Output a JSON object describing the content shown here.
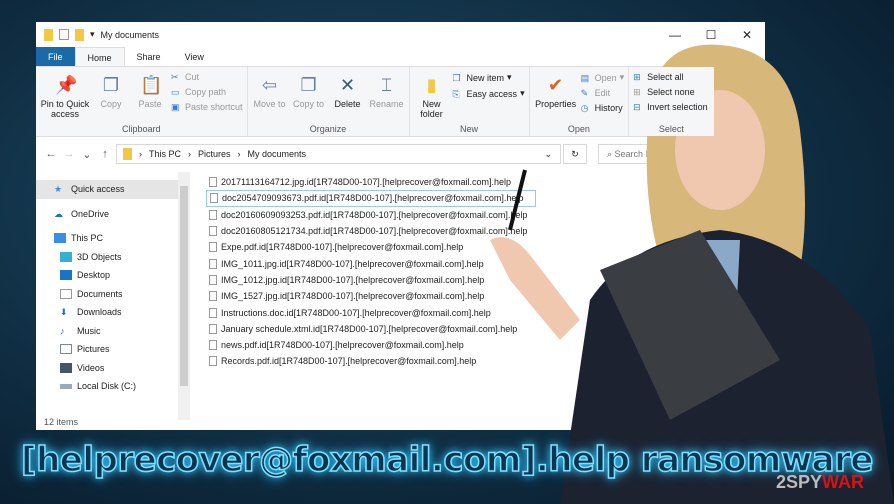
{
  "window": {
    "title": "My documents",
    "controls": [
      "—",
      "☐",
      "✕"
    ]
  },
  "tabs": [
    "File",
    "Home",
    "Share",
    "View"
  ],
  "ribbon": {
    "clipboard": {
      "label": "Clipboard",
      "pin": "Pin to Quick access",
      "copy": "Copy",
      "paste": "Paste",
      "cut": "Cut",
      "copy_path": "Copy path",
      "paste_shortcut": "Paste shortcut"
    },
    "organize": {
      "label": "Organize",
      "move_to": "Move to",
      "copy_to": "Copy to",
      "delete": "Delete",
      "rename": "Rename"
    },
    "new": {
      "label": "New",
      "new_folder": "New folder",
      "new_item": "New item",
      "easy_access": "Easy access"
    },
    "open": {
      "label": "Open",
      "properties": "Properties",
      "open": "Open",
      "edit": "Edit",
      "history": "History"
    },
    "select": {
      "label": "Select",
      "select_all": "Select all",
      "select_none": "Select none",
      "invert": "Invert selection"
    }
  },
  "address": {
    "crumbs": [
      "This PC",
      "Pictures",
      "My documents"
    ],
    "search_placeholder": "Search My do"
  },
  "nav": [
    "Quick access",
    "OneDrive",
    "This PC",
    "3D Objects",
    "Desktop",
    "Documents",
    "Downloads",
    "Music",
    "Pictures",
    "Videos",
    "Local Disk (C:)"
  ],
  "files": [
    "20171113164712.jpg.id[1R748D00-107].[helprecover@foxmail.com].help",
    "doc2054709093673.pdf.id[1R748D00-107].[helprecover@foxmail.com].help",
    "doc20160609093253.pdf.id[1R748D00-107].[helprecover@foxmail.com].help",
    "doc20160805121734.pdf.id[1R748D00-107].[helprecover@foxmail.com].help",
    "Expe.pdf.id[1R748D00-107].[helprecover@foxmail.com].help",
    "IMG_1011.jpg.id[1R748D00-107].[helprecover@foxmail.com].help",
    "IMG_1012.jpg.id[1R748D00-107].[helprecover@foxmail.com].help",
    "IMG_1527.jpg.id[1R748D00-107].[helprecover@foxmail.com].help",
    "Instructions.doc.id[1R748D00-107].[helprecover@foxmail.com].help",
    "January schedule.xtml.id[1R748D00-107].[helprecover@foxmail.com].help",
    "news.pdf.id[1R748D00-107].[helprecover@foxmail.com].help",
    "Records.pdf.id[1R748D00-107].[helprecover@foxmail.com].help"
  ],
  "status": "12 items",
  "headline": "[helprecover@foxmail.com].help ransomware",
  "logo": {
    "prefix": "2SPY",
    "suffix": "WAR"
  }
}
